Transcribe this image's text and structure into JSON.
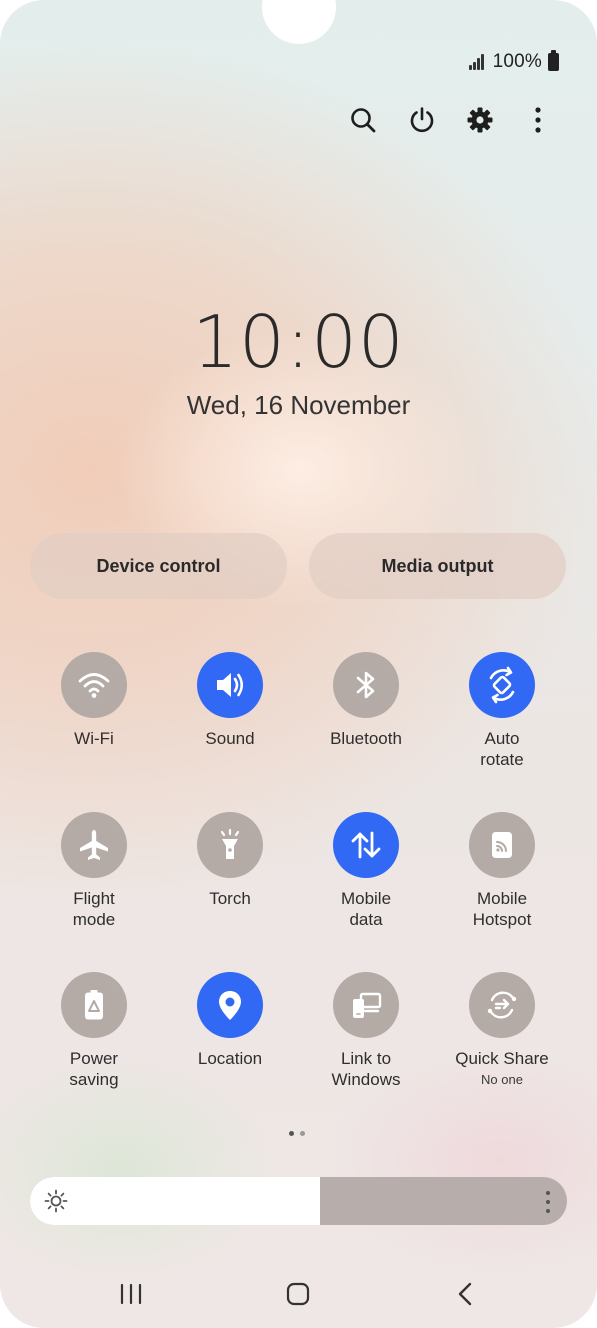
{
  "status": {
    "battery_text": "100%"
  },
  "top_icons": [
    {
      "name": "search-icon"
    },
    {
      "name": "power-icon"
    },
    {
      "name": "settings-gear-icon"
    },
    {
      "name": "more-options-icon"
    }
  ],
  "clock": {
    "time": "10:00",
    "date": "Wed, 16 November"
  },
  "quick_buttons": {
    "device_control": "Device control",
    "media_output": "Media output"
  },
  "tiles": [
    {
      "label": "Wi-Fi",
      "state": "off",
      "icon": "wifi-icon"
    },
    {
      "label": "Sound",
      "state": "on",
      "icon": "sound-icon"
    },
    {
      "label": "Bluetooth",
      "state": "off",
      "icon": "bluetooth-icon"
    },
    {
      "label": "Auto\nrotate",
      "state": "on",
      "icon": "auto-rotate-icon"
    },
    {
      "label": "Flight\nmode",
      "state": "off",
      "icon": "airplane-icon"
    },
    {
      "label": "Torch",
      "state": "off",
      "icon": "torch-icon"
    },
    {
      "label": "Mobile\ndata",
      "state": "on",
      "icon": "mobile-data-icon"
    },
    {
      "label": "Mobile\nHotspot",
      "state": "off",
      "icon": "hotspot-icon"
    },
    {
      "label": "Power\nsaving",
      "state": "off",
      "icon": "power-saving-icon"
    },
    {
      "label": "Location",
      "state": "on",
      "icon": "location-icon"
    },
    {
      "label": "Link to\nWindows",
      "state": "off",
      "icon": "link-to-windows-icon"
    },
    {
      "label": "Quick Share",
      "sub": "No one",
      "state": "off",
      "icon": "quick-share-icon"
    }
  ],
  "page_indicator": {
    "pages": 2,
    "current": 1
  },
  "brightness": {
    "level": 0.54
  },
  "colors": {
    "tile_on": "#3169f5",
    "tile_off": "#b4aaa6"
  },
  "navbar": [
    {
      "name": "recent-apps-icon"
    },
    {
      "name": "home-icon"
    },
    {
      "name": "back-icon"
    }
  ]
}
